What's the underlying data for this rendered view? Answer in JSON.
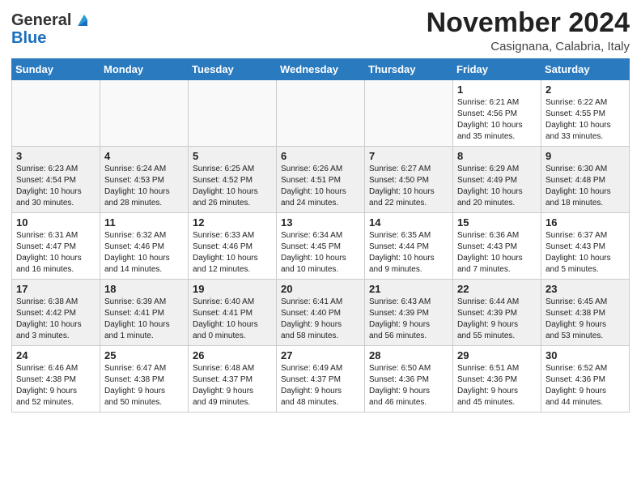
{
  "logo": {
    "general": "General",
    "blue": "Blue"
  },
  "header": {
    "month": "November 2024",
    "location": "Casignana, Calabria, Italy"
  },
  "days_of_week": [
    "Sunday",
    "Monday",
    "Tuesday",
    "Wednesday",
    "Thursday",
    "Friday",
    "Saturday"
  ],
  "weeks": [
    [
      {
        "day": "",
        "info": ""
      },
      {
        "day": "",
        "info": ""
      },
      {
        "day": "",
        "info": ""
      },
      {
        "day": "",
        "info": ""
      },
      {
        "day": "",
        "info": ""
      },
      {
        "day": "1",
        "info": "Sunrise: 6:21 AM\nSunset: 4:56 PM\nDaylight: 10 hours\nand 35 minutes."
      },
      {
        "day": "2",
        "info": "Sunrise: 6:22 AM\nSunset: 4:55 PM\nDaylight: 10 hours\nand 33 minutes."
      }
    ],
    [
      {
        "day": "3",
        "info": "Sunrise: 6:23 AM\nSunset: 4:54 PM\nDaylight: 10 hours\nand 30 minutes."
      },
      {
        "day": "4",
        "info": "Sunrise: 6:24 AM\nSunset: 4:53 PM\nDaylight: 10 hours\nand 28 minutes."
      },
      {
        "day": "5",
        "info": "Sunrise: 6:25 AM\nSunset: 4:52 PM\nDaylight: 10 hours\nand 26 minutes."
      },
      {
        "day": "6",
        "info": "Sunrise: 6:26 AM\nSunset: 4:51 PM\nDaylight: 10 hours\nand 24 minutes."
      },
      {
        "day": "7",
        "info": "Sunrise: 6:27 AM\nSunset: 4:50 PM\nDaylight: 10 hours\nand 22 minutes."
      },
      {
        "day": "8",
        "info": "Sunrise: 6:29 AM\nSunset: 4:49 PM\nDaylight: 10 hours\nand 20 minutes."
      },
      {
        "day": "9",
        "info": "Sunrise: 6:30 AM\nSunset: 4:48 PM\nDaylight: 10 hours\nand 18 minutes."
      }
    ],
    [
      {
        "day": "10",
        "info": "Sunrise: 6:31 AM\nSunset: 4:47 PM\nDaylight: 10 hours\nand 16 minutes."
      },
      {
        "day": "11",
        "info": "Sunrise: 6:32 AM\nSunset: 4:46 PM\nDaylight: 10 hours\nand 14 minutes."
      },
      {
        "day": "12",
        "info": "Sunrise: 6:33 AM\nSunset: 4:46 PM\nDaylight: 10 hours\nand 12 minutes."
      },
      {
        "day": "13",
        "info": "Sunrise: 6:34 AM\nSunset: 4:45 PM\nDaylight: 10 hours\nand 10 minutes."
      },
      {
        "day": "14",
        "info": "Sunrise: 6:35 AM\nSunset: 4:44 PM\nDaylight: 10 hours\nand 9 minutes."
      },
      {
        "day": "15",
        "info": "Sunrise: 6:36 AM\nSunset: 4:43 PM\nDaylight: 10 hours\nand 7 minutes."
      },
      {
        "day": "16",
        "info": "Sunrise: 6:37 AM\nSunset: 4:43 PM\nDaylight: 10 hours\nand 5 minutes."
      }
    ],
    [
      {
        "day": "17",
        "info": "Sunrise: 6:38 AM\nSunset: 4:42 PM\nDaylight: 10 hours\nand 3 minutes."
      },
      {
        "day": "18",
        "info": "Sunrise: 6:39 AM\nSunset: 4:41 PM\nDaylight: 10 hours\nand 1 minute."
      },
      {
        "day": "19",
        "info": "Sunrise: 6:40 AM\nSunset: 4:41 PM\nDaylight: 10 hours\nand 0 minutes."
      },
      {
        "day": "20",
        "info": "Sunrise: 6:41 AM\nSunset: 4:40 PM\nDaylight: 9 hours\nand 58 minutes."
      },
      {
        "day": "21",
        "info": "Sunrise: 6:43 AM\nSunset: 4:39 PM\nDaylight: 9 hours\nand 56 minutes."
      },
      {
        "day": "22",
        "info": "Sunrise: 6:44 AM\nSunset: 4:39 PM\nDaylight: 9 hours\nand 55 minutes."
      },
      {
        "day": "23",
        "info": "Sunrise: 6:45 AM\nSunset: 4:38 PM\nDaylight: 9 hours\nand 53 minutes."
      }
    ],
    [
      {
        "day": "24",
        "info": "Sunrise: 6:46 AM\nSunset: 4:38 PM\nDaylight: 9 hours\nand 52 minutes."
      },
      {
        "day": "25",
        "info": "Sunrise: 6:47 AM\nSunset: 4:38 PM\nDaylight: 9 hours\nand 50 minutes."
      },
      {
        "day": "26",
        "info": "Sunrise: 6:48 AM\nSunset: 4:37 PM\nDaylight: 9 hours\nand 49 minutes."
      },
      {
        "day": "27",
        "info": "Sunrise: 6:49 AM\nSunset: 4:37 PM\nDaylight: 9 hours\nand 48 minutes."
      },
      {
        "day": "28",
        "info": "Sunrise: 6:50 AM\nSunset: 4:36 PM\nDaylight: 9 hours\nand 46 minutes."
      },
      {
        "day": "29",
        "info": "Sunrise: 6:51 AM\nSunset: 4:36 PM\nDaylight: 9 hours\nand 45 minutes."
      },
      {
        "day": "30",
        "info": "Sunrise: 6:52 AM\nSunset: 4:36 PM\nDaylight: 9 hours\nand 44 minutes."
      }
    ]
  ]
}
